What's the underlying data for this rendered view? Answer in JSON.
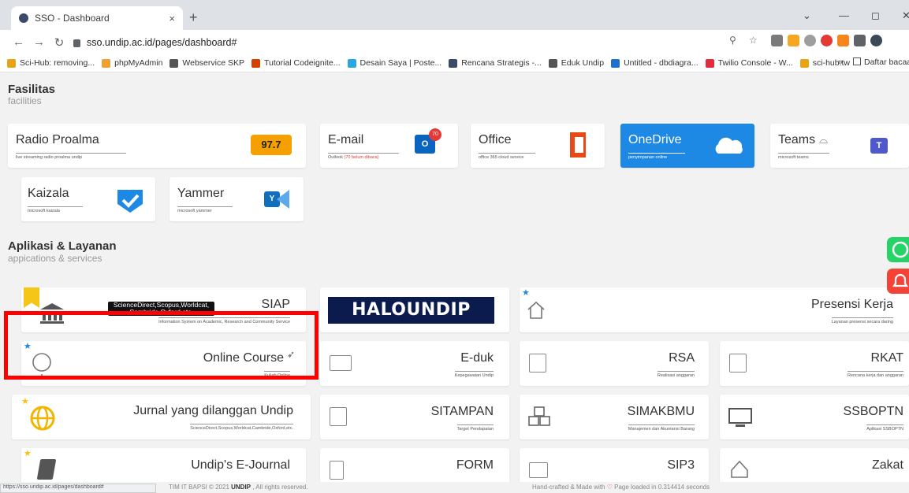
{
  "browser": {
    "tab_title": "SSO - Dashboard",
    "tab_close": "×",
    "new_tab": "+",
    "url": "sso.undip.ac.id/pages/dashboard#",
    "status_url": "https://sso.undip.ac.id/pages/dashboard#"
  },
  "bookmarks": [
    {
      "label": "Sci-Hub: removing...",
      "color": "#e8a317"
    },
    {
      "label": "phpMyAdmin",
      "color": "#f0a030"
    },
    {
      "label": "Webservice SKP",
      "color": "#555555"
    },
    {
      "label": "Tutorial Codeignite...",
      "color": "#d44000"
    },
    {
      "label": "Desain Saya | Poste...",
      "color": "#29a8e0"
    },
    {
      "label": "Rencana Strategis -...",
      "color": "#3b4a6b"
    },
    {
      "label": "Eduk Undip",
      "color": "#555555"
    },
    {
      "label": "Untitled - dbdiagra...",
      "color": "#1f6fd0"
    },
    {
      "label": "Twilio Console - W...",
      "color": "#e22d3f"
    },
    {
      "label": "sci-hub.tw",
      "color": "#e8a317"
    }
  ],
  "bookmarks_more": "»",
  "reading_list": "Daftar bacaan",
  "facilities": {
    "title": "Fasilitas",
    "subtitle": "facilities",
    "cards": [
      {
        "title": "Radio Proalma",
        "sub": "live streaming radio proalma undip",
        "badge": "97.7"
      },
      {
        "title": "E-mail",
        "sub": "Outlook",
        "sub_note": "(70 belum dibaca)",
        "badge": "70"
      },
      {
        "title": "Office",
        "sub": "office 365 cloud service"
      },
      {
        "title": "OneDrive",
        "sub": "penyimpanan online"
      },
      {
        "title": "Teams",
        "sub": "microsoft teams"
      },
      {
        "title": "Kaizala",
        "sub": "microsoft kaizala"
      },
      {
        "title": "Yammer",
        "sub": "microsoft yammer"
      }
    ]
  },
  "apps": {
    "title": "Aplikasi & Layanan",
    "subtitle": "appications & services",
    "cards": [
      {
        "title": "SIAP",
        "sub": "Information System on Academic, Research and Community Service"
      },
      {
        "title": "HALOUNDIP"
      },
      {
        "title": "Presensi Kerja",
        "sub": "Layanan presensi secara daring"
      },
      {
        "title": "Online Course",
        "sub": "Kuliah Online"
      },
      {
        "title": "E-duk",
        "sub": "Kepegawaian Undip"
      },
      {
        "title": "RSA",
        "sub": "Realisasi anggaran"
      },
      {
        "title": "RKAT",
        "sub": "Rencana kerja dan anggaran"
      },
      {
        "title": "Jurnal yang dilanggan Undip",
        "sub": "ScienceDirect,Scopus,Worldcat,Cambride,Oxford,etc."
      },
      {
        "title": "SITAMPAN",
        "sub": "Target Pendapatan"
      },
      {
        "title": "SIMAKBMU",
        "sub": "Manajemen dan Akuntansi Barang"
      },
      {
        "title": "SSBOPTN",
        "sub": "Aplikasi SSBOPTN"
      },
      {
        "title": "Undip's E-Journal"
      },
      {
        "title": "FORM"
      },
      {
        "title": "SIP3"
      },
      {
        "title": "Zakat"
      }
    ]
  },
  "tooltip": {
    "line1": "ScienceDirect,Scopus,Worldcat,",
    "line2": "Cambride,Oxford,etc."
  },
  "footer": {
    "left_prefix": "TIM IT BAPSI © 2021 ",
    "left_org": "UNDIP",
    "left_suffix": " , All rights reserved.",
    "right_prefix": "Hand-crafted & Made with",
    "right_suffix": "Page loaded in 0.314414 seconds"
  },
  "colors": {
    "accent": "#1e88e5",
    "highlight": "#ff0000",
    "star": "#ffc107",
    "whatsapp": "#25d366",
    "notif": "#f44336"
  }
}
